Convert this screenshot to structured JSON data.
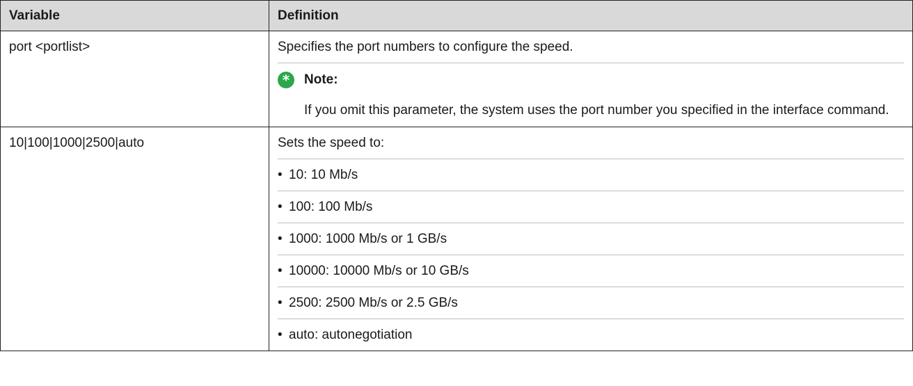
{
  "table": {
    "headers": {
      "variable": "Variable",
      "definition": "Definition"
    },
    "rows": [
      {
        "variable": "port <portlist>",
        "description": "Specifies the port numbers to configure the speed.",
        "note_title": "Note:",
        "note_text": "If you omit this parameter, the system uses the port number you specified in the interface command."
      },
      {
        "variable": "10|100|1000|2500|auto",
        "intro": "Sets the speed to:",
        "items": [
          "10: 10 Mb/s",
          "100: 100 Mb/s",
          "1000: 1000 Mb/s or 1 GB/s",
          "10000: 10000 Mb/s or 10 GB/s",
          "2500: 2500 Mb/s or 2.5 GB/s",
          "auto: autonegotiation"
        ]
      }
    ]
  },
  "icons": {
    "note": "asterisk-icon"
  },
  "colors": {
    "header_bg": "#d9d9d9",
    "note_icon": "#2aa84a"
  }
}
